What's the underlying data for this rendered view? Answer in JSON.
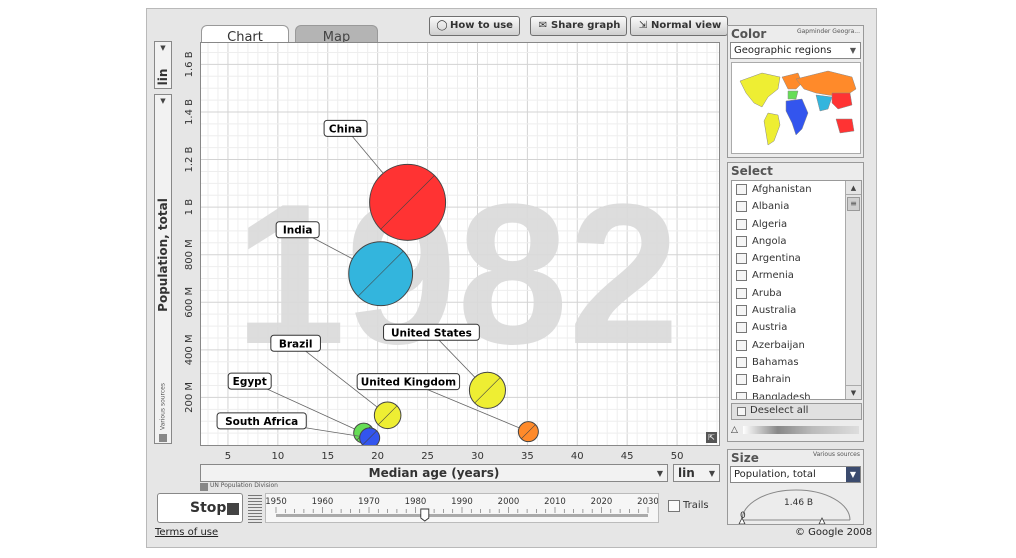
{
  "tabs": {
    "chart": "Chart",
    "map": "Map"
  },
  "toolbar": {
    "how_to_use": "How to use",
    "share_graph": "Share graph",
    "normal_view": "Normal view"
  },
  "y_axis": {
    "scale": "lin",
    "label": "Population, total",
    "source": "Various sources"
  },
  "x_axis": {
    "label": "Median age (years)",
    "scale": "lin",
    "source": "UN Population Division"
  },
  "year_watermark": "1982",
  "color_panel": {
    "title": "Color",
    "credit": "Gapminder Geogra...",
    "selected": "Geographic regions"
  },
  "select_panel": {
    "title": "Select",
    "countries": [
      "Afghanistan",
      "Albania",
      "Algeria",
      "Angola",
      "Argentina",
      "Armenia",
      "Aruba",
      "Australia",
      "Austria",
      "Azerbaijan",
      "Bahamas",
      "Bahrain",
      "Bangladesh"
    ],
    "deselect_all": "Deselect all"
  },
  "size_panel": {
    "title": "Size",
    "source": "Various sources",
    "selected": "Population, total",
    "gauge_value": "1.46 B",
    "gauge_min": "0"
  },
  "player": {
    "stop_label": "Stop",
    "trails_label": "Trails",
    "years": [
      "1950",
      "1960",
      "1970",
      "1980",
      "1990",
      "2000",
      "2010",
      "2020",
      "2030"
    ],
    "current_year": 1982,
    "year_range": [
      1950,
      2030
    ]
  },
  "footer": {
    "terms": "Terms of use",
    "copyright": "© Google 2008"
  },
  "colors": {
    "red": "#ff3333",
    "cyan": "#33b5dd",
    "yellow": "#eeee33",
    "green": "#66dd55",
    "blue": "#3355ee",
    "orange": "#ff8a2a"
  },
  "chart_data": {
    "type": "scatter",
    "xlabel": "Median age (years)",
    "ylabel": "Population, total",
    "xlim": [
      2.3,
      54.2
    ],
    "ylim": [
      0,
      1.69
    ],
    "x_ticks": [
      "5",
      "10",
      "15",
      "20",
      "25",
      "30",
      "35",
      "40",
      "45",
      "50"
    ],
    "y_ticks": [
      "200 M",
      "400 M",
      "600 M",
      "800 M",
      "1 B",
      "1.2 B",
      "1.4 B",
      "1.6 B"
    ],
    "grid": true,
    "points": [
      {
        "name": "China",
        "x": 23.0,
        "y": 1.02,
        "size": 1.02,
        "color": "#ff3333"
      },
      {
        "name": "India",
        "x": 20.3,
        "y": 0.72,
        "size": 0.72,
        "color": "#33b5dd"
      },
      {
        "name": "United States",
        "x": 31.0,
        "y": 0.23,
        "size": 0.23,
        "color": "#eeee33"
      },
      {
        "name": "Brazil",
        "x": 21.0,
        "y": 0.125,
        "size": 0.125,
        "color": "#eeee33"
      },
      {
        "name": "United Kingdom",
        "x": 35.1,
        "y": 0.056,
        "size": 0.056,
        "color": "#ff8a2a"
      },
      {
        "name": "Egypt",
        "x": 18.6,
        "y": 0.05,
        "size": 0.05,
        "color": "#66dd55"
      },
      {
        "name": "South Africa",
        "x": 19.2,
        "y": 0.03,
        "size": 0.03,
        "color": "#3355ee"
      }
    ]
  }
}
